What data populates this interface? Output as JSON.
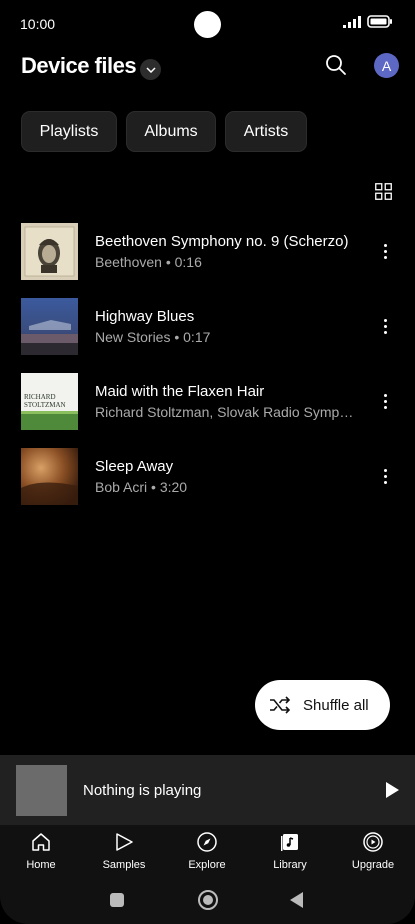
{
  "status_bar": {
    "time": "10:00"
  },
  "header": {
    "title": "Device files",
    "avatar_letter": "A"
  },
  "chips": [
    "Playlists",
    "Albums",
    "Artists"
  ],
  "tracks": [
    {
      "title": "Beethoven Symphony no. 9 (Scherzo)",
      "subtitle": "Beethoven • 0:16"
    },
    {
      "title": "Highway Blues",
      "subtitle": "New Stories • 0:17"
    },
    {
      "title": "Maid with the Flaxen Hair",
      "subtitle": "Richard Stoltzman, Slovak Radio Symp…"
    },
    {
      "title": "Sleep Away",
      "subtitle": "Bob Acri • 3:20"
    }
  ],
  "album_art_text": {
    "stoltzman_line1": "RICHARD",
    "stoltzman_line2": "STOLTZMAN"
  },
  "shuffle": {
    "label": "Shuffle all"
  },
  "mini_player": {
    "text": "Nothing is playing"
  },
  "bottom_nav": [
    {
      "label": "Home",
      "icon": "home-icon"
    },
    {
      "label": "Samples",
      "icon": "samples-icon"
    },
    {
      "label": "Explore",
      "icon": "explore-icon"
    },
    {
      "label": "Library",
      "icon": "library-icon"
    },
    {
      "label": "Upgrade",
      "icon": "upgrade-icon"
    }
  ],
  "colors": {
    "background": "#000000",
    "avatar": "#5d68c4",
    "chip": "#1f1f1f",
    "mini_player": "#212121"
  }
}
